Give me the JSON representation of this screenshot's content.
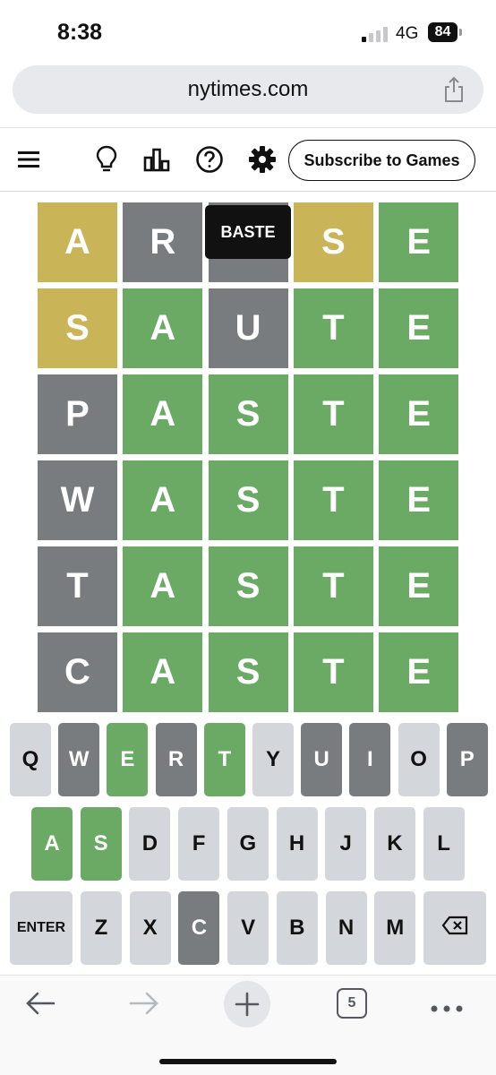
{
  "status_bar": {
    "time": "8:38",
    "network": "4G",
    "battery": "84"
  },
  "browser": {
    "url": "nytimes.com",
    "share_icon": "share-icon"
  },
  "game_header": {
    "icons": [
      "menu-icon",
      "lightbulb-icon",
      "stats-icon",
      "help-icon",
      "settings-icon"
    ],
    "subscribe_label": "Subscribe to Games"
  },
  "toast": "BASTE",
  "board": {
    "rows": [
      [
        {
          "letter": "A",
          "state": "present"
        },
        {
          "letter": "R",
          "state": "absent"
        },
        {
          "letter": "B",
          "state": "absent"
        },
        {
          "letter": "S",
          "state": "present"
        },
        {
          "letter": "E",
          "state": "correct"
        }
      ],
      [
        {
          "letter": "S",
          "state": "present"
        },
        {
          "letter": "A",
          "state": "correct"
        },
        {
          "letter": "U",
          "state": "absent"
        },
        {
          "letter": "T",
          "state": "correct"
        },
        {
          "letter": "E",
          "state": "correct"
        }
      ],
      [
        {
          "letter": "P",
          "state": "absent"
        },
        {
          "letter": "A",
          "state": "correct"
        },
        {
          "letter": "S",
          "state": "correct"
        },
        {
          "letter": "T",
          "state": "correct"
        },
        {
          "letter": "E",
          "state": "correct"
        }
      ],
      [
        {
          "letter": "W",
          "state": "absent"
        },
        {
          "letter": "A",
          "state": "correct"
        },
        {
          "letter": "S",
          "state": "correct"
        },
        {
          "letter": "T",
          "state": "correct"
        },
        {
          "letter": "E",
          "state": "correct"
        }
      ],
      [
        {
          "letter": "T",
          "state": "absent"
        },
        {
          "letter": "A",
          "state": "correct"
        },
        {
          "letter": "S",
          "state": "correct"
        },
        {
          "letter": "T",
          "state": "correct"
        },
        {
          "letter": "E",
          "state": "correct"
        }
      ],
      [
        {
          "letter": "C",
          "state": "absent"
        },
        {
          "letter": "A",
          "state": "correct"
        },
        {
          "letter": "S",
          "state": "correct"
        },
        {
          "letter": "T",
          "state": "correct"
        },
        {
          "letter": "E",
          "state": "correct"
        }
      ]
    ]
  },
  "keyboard": {
    "row1": [
      {
        "label": "Q",
        "state": "unused"
      },
      {
        "label": "W",
        "state": "absent"
      },
      {
        "label": "E",
        "state": "correct"
      },
      {
        "label": "R",
        "state": "absent"
      },
      {
        "label": "T",
        "state": "correct"
      },
      {
        "label": "Y",
        "state": "unused"
      },
      {
        "label": "U",
        "state": "absent"
      },
      {
        "label": "I",
        "state": "absent"
      },
      {
        "label": "O",
        "state": "unused"
      },
      {
        "label": "P",
        "state": "absent"
      }
    ],
    "row2": [
      {
        "label": "A",
        "state": "correct"
      },
      {
        "label": "S",
        "state": "correct"
      },
      {
        "label": "D",
        "state": "unused"
      },
      {
        "label": "F",
        "state": "unused"
      },
      {
        "label": "G",
        "state": "unused"
      },
      {
        "label": "H",
        "state": "unused"
      },
      {
        "label": "J",
        "state": "unused"
      },
      {
        "label": "K",
        "state": "unused"
      },
      {
        "label": "L",
        "state": "unused"
      }
    ],
    "row3": [
      {
        "label": "ENTER",
        "state": "unused"
      },
      {
        "label": "Z",
        "state": "unused"
      },
      {
        "label": "X",
        "state": "unused"
      },
      {
        "label": "C",
        "state": "absent"
      },
      {
        "label": "V",
        "state": "unused"
      },
      {
        "label": "B",
        "state": "unused"
      },
      {
        "label": "N",
        "state": "unused"
      },
      {
        "label": "M",
        "state": "unused"
      },
      {
        "label": "",
        "state": "unused",
        "icon": "backspace-icon"
      }
    ]
  },
  "bottom_bar": {
    "tab_count": "5",
    "icons": [
      "back-arrow-icon",
      "forward-arrow-icon",
      "new-tab-icon",
      "tabs-icon",
      "more-icon"
    ]
  },
  "colors": {
    "correct": "#6aaa64",
    "present": "#c9b458",
    "absent": "#787c7e",
    "unused": "#d3d6da"
  }
}
